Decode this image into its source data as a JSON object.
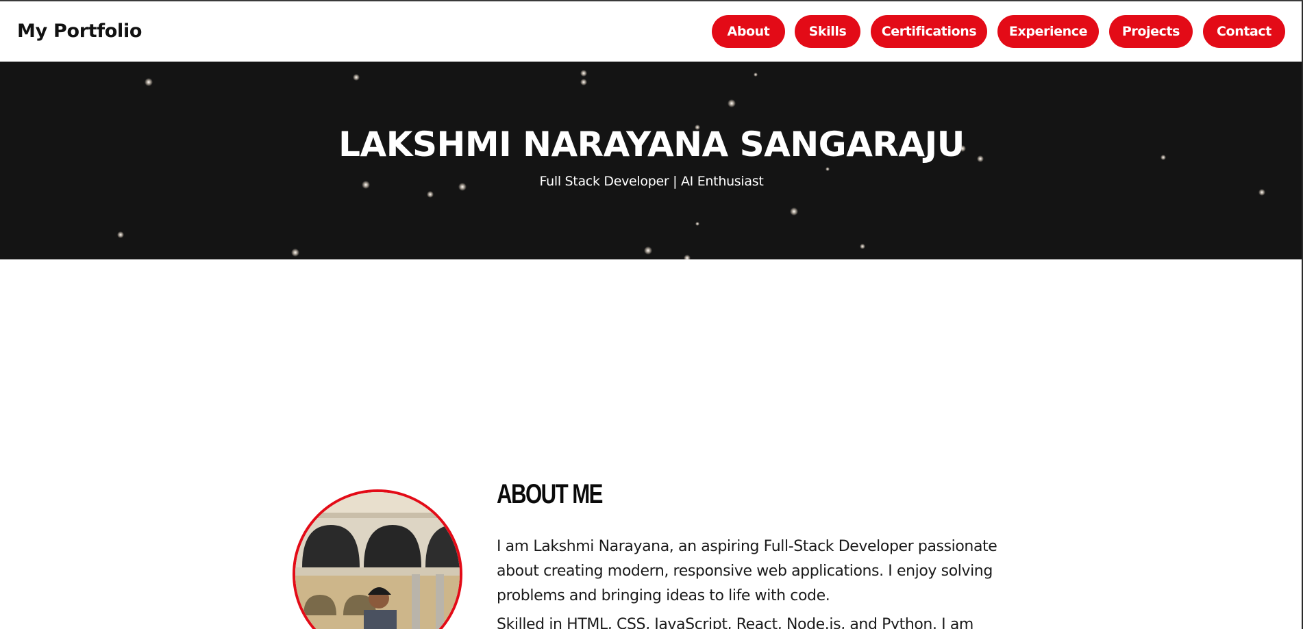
{
  "brand": "My Portfolio",
  "nav": {
    "items": [
      {
        "label": "About"
      },
      {
        "label": "Skills"
      },
      {
        "label": "Certifications"
      },
      {
        "label": "Experience"
      },
      {
        "label": "Projects"
      },
      {
        "label": "Contact"
      }
    ]
  },
  "hero": {
    "name": "LAKSHMI NARAYANA SANGARAJU",
    "tagline": "Full Stack Developer | AI Enthusiast"
  },
  "about": {
    "heading": "ABOUT ME",
    "paragraphs": [
      "I am Lakshmi Narayana, an aspiring Full-Stack Developer passionate about creating modern, responsive web applications. I enjoy solving problems and bringing ideas to life with code.",
      "Skilled in HTML, CSS, JavaScript, React, Node.js, and Python. I am"
    ]
  },
  "colors": {
    "accent": "#e30b17",
    "hero_bg": "#141414",
    "text": "#111111"
  }
}
